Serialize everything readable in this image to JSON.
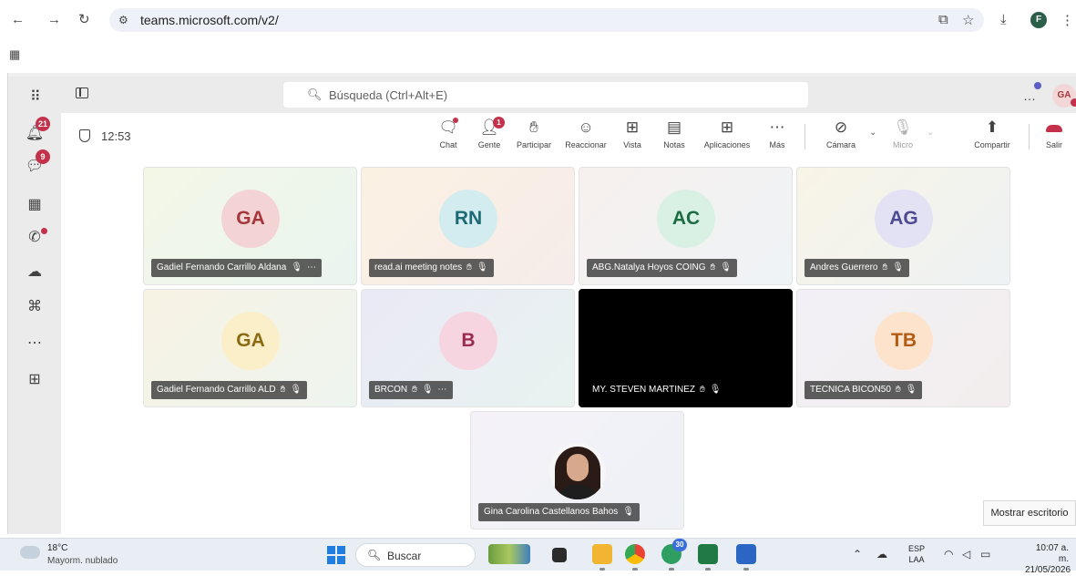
{
  "browser": {
    "url": "teams.microsoft.com/v2/",
    "profile_initial": "F"
  },
  "teams": {
    "search_placeholder": "Búsqueda (Ctrl+Alt+E)",
    "user_initials": "GA",
    "rail": {
      "activity_badge": "21",
      "chat_badge": "9"
    },
    "meeting": {
      "elapsed": "12:53",
      "controls": {
        "chat": "Chat",
        "people": "Gente",
        "people_count": "1",
        "raise_hand": "Participar",
        "react": "Reaccionar",
        "view": "Vista",
        "notes": "Notas",
        "apps": "Aplicaciones",
        "more": "Más",
        "camera": "Cámara",
        "mic": "Micro",
        "share": "Compartir",
        "leave": "Salir"
      },
      "participants": [
        {
          "initials": "GA",
          "name": "Gadiel Fernando Carrillo Aldana",
          "avatar_bg": "#f4d3d4",
          "avatar_fg": "#a4373a",
          "tile_bg": "linear-gradient(135deg,#f3f7e6,#eaf5f0)"
        },
        {
          "initials": "RN",
          "name": "read.ai meeting notes",
          "avatar_bg": "#d3ecef",
          "avatar_fg": "#1d6a76",
          "tile_bg": "linear-gradient(135deg,#fbf1e2,#f6ecea)"
        },
        {
          "initials": "AC",
          "name": "ABG.Natalya Hoyos COING",
          "avatar_bg": "#d9f0e4",
          "avatar_fg": "#1d6b43",
          "tile_bg": "linear-gradient(135deg,#f7f0ee,#eef3f6)"
        },
        {
          "initials": "AG",
          "name": "Andres Guerrero",
          "avatar_bg": "#e3e2f4",
          "avatar_fg": "#4f4a8f",
          "tile_bg": "linear-gradient(135deg,#f8f4e6,#eef2f4)"
        },
        {
          "initials": "GA",
          "name": "Gadiel Fernando Carrillo ALD",
          "avatar_bg": "#fbefc9",
          "avatar_fg": "#8a6b12",
          "tile_bg": "linear-gradient(135deg,#f7f3e4,#eef4ef)"
        },
        {
          "initials": "B",
          "name": "BRCON",
          "avatar_bg": "#f6d5e0",
          "avatar_fg": "#9b2c4f",
          "tile_bg": "linear-gradient(135deg,#eae9f6,#e8f3ef)"
        },
        {
          "initials": "",
          "name": "MY. STEVEN MARTINEZ",
          "avatar_bg": "#000000",
          "avatar_fg": "#ffffff",
          "tile_bg": "#000000"
        },
        {
          "initials": "TB",
          "name": "TECNICA BICON50",
          "avatar_bg": "#fde3cc",
          "avatar_fg": "#b25b13",
          "tile_bg": "linear-gradient(135deg,#f2f0f6,#f3eeed)"
        },
        {
          "initials": "",
          "name": "Gina Carolina Castellanos Bahos",
          "avatar_bg": "#f6f6f6",
          "avatar_fg": "#000000",
          "tile_bg": "linear-gradient(135deg,#f4f2f8,#eef1f6)"
        }
      ]
    },
    "show_desktop": "Mostrar escritorio"
  },
  "taskbar": {
    "temperature": "18°C",
    "weather": "Mayorm. nublado",
    "search": "Buscar",
    "chrome_badge": "30",
    "lang_top": "ESP",
    "lang_bottom": "LAA",
    "time": "10:07 a. m.",
    "date": "21/05/2026"
  },
  "icons": {
    "back": "arrow-left-icon",
    "forward": "arrow-right-icon",
    "reload": "reload-icon",
    "apps": "apps-grid-icon",
    "mic_off": "mic-off-icon",
    "hand": "hand-icon"
  }
}
